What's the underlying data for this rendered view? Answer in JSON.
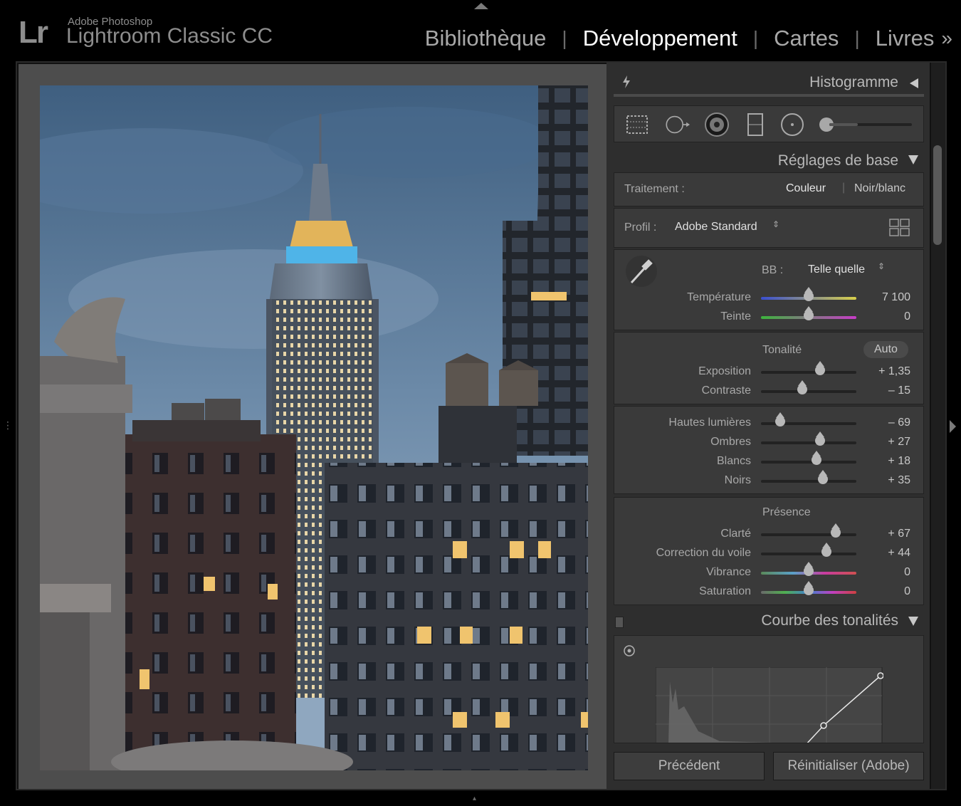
{
  "app": {
    "logo": "Lr",
    "vendor": "Adobe Photoshop",
    "product": "Lightroom Classic CC"
  },
  "modules": {
    "library": "Bibliothèque",
    "develop": "Développement",
    "map": "Cartes",
    "book": "Livres",
    "more_icon": "double-chevron-right-icon",
    "separator": "|"
  },
  "panels": {
    "histogram": "Histogramme",
    "basic": "Réglages de base",
    "tone_curve": "Courbe des tonalités"
  },
  "treatment": {
    "label": "Traitement :",
    "color": "Couleur",
    "bw": "Noir/blanc"
  },
  "profile": {
    "label": "Profil :",
    "value": "Adobe Standard"
  },
  "wb": {
    "label": "BB :",
    "value": "Telle quelle",
    "temperature": {
      "label": "Température",
      "value": "7 100",
      "pos": 0.5
    },
    "tint": {
      "label": "Teinte",
      "value": "0",
      "pos": 0.5
    }
  },
  "tone": {
    "title": "Tonalité",
    "auto": "Auto",
    "exposure": {
      "label": "Exposition",
      "value": "+ 1,35",
      "pos": 0.62
    },
    "contrast": {
      "label": "Contraste",
      "value": "– 15",
      "pos": 0.43
    }
  },
  "highlights": {
    "highlights": {
      "label": "Hautes lumières",
      "value": "– 69",
      "pos": 0.2
    },
    "shadows": {
      "label": "Ombres",
      "value": "+ 27",
      "pos": 0.62
    },
    "whites": {
      "label": "Blancs",
      "value": "+ 18",
      "pos": 0.58
    },
    "blacks": {
      "label": "Noirs",
      "value": "+ 35",
      "pos": 0.65
    }
  },
  "presence": {
    "title": "Présence",
    "clarity": {
      "label": "Clarté",
      "value": "+ 67",
      "pos": 0.78
    },
    "dehaze": {
      "label": "Correction du voile",
      "value": "+ 44",
      "pos": 0.69
    },
    "vibrance": {
      "label": "Vibrance",
      "value": "0",
      "pos": 0.5
    },
    "saturation": {
      "label": "Saturation",
      "value": "0",
      "pos": 0.5
    }
  },
  "buttons": {
    "previous": "Précédent",
    "reset": "Réinitialiser (Adobe)"
  },
  "colors": {
    "background": "#000000",
    "panel": "#2e2e2e",
    "section": "#3a3a3a",
    "active_module": "#ffffff",
    "inactive_module": "#a8a8a8"
  }
}
